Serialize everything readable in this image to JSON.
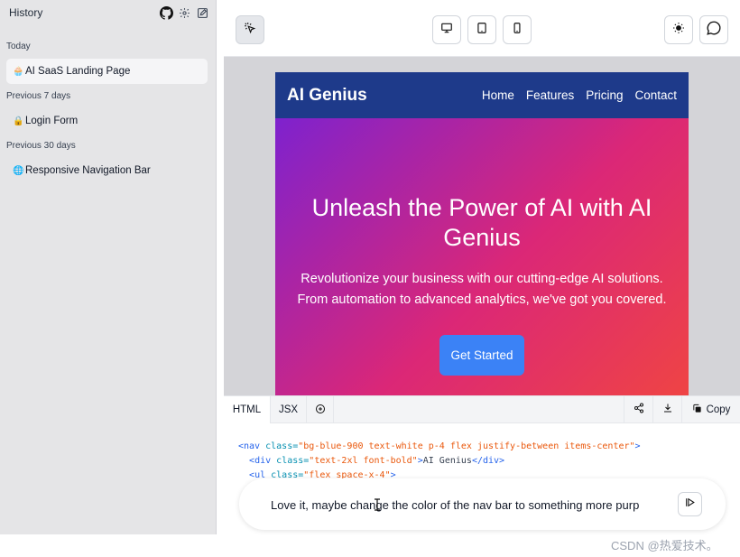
{
  "sidebar": {
    "title": "History",
    "icons": [
      "github-icon",
      "gear-icon",
      "edit-icon"
    ],
    "sections": [
      {
        "label": "Today",
        "items": [
          {
            "emoji": "🧁",
            "label": "AI SaaS Landing Page"
          }
        ]
      },
      {
        "label": "Previous 7 days",
        "items": [
          {
            "emoji": "🔒",
            "label": "Login Form"
          }
        ]
      },
      {
        "label": "Previous 30 days",
        "items": [
          {
            "emoji": "🌐",
            "label": "Responsive Navigation Bar"
          }
        ]
      }
    ]
  },
  "toolbar": {
    "buttons": [
      "pointer-select-icon",
      "desktop-icon",
      "tablet-icon",
      "mobile-icon",
      "sun-icon",
      "chat-bubble-icon"
    ]
  },
  "preview": {
    "logo": "AI Genius",
    "nav_links": [
      "Home",
      "Features",
      "Pricing",
      "Contact"
    ],
    "hero_title": "Unleash the Power of AI with AI Genius",
    "hero_subtitle": "Revolutionize your business with our cutting-edge AI solutions. From automation to advanced analytics, we've got you covered.",
    "cta": "Get Started",
    "colors": {
      "nav": "#1e3a8a",
      "gradient_start": "#7e22ce",
      "gradient_mid": "#db2777",
      "gradient_end": "#ef4444",
      "cta": "#3b82f6"
    }
  },
  "code_panel": {
    "tabs": [
      "HTML",
      "JSX"
    ],
    "copy_label": "Copy",
    "lines": [
      {
        "tag_open": "<nav",
        "attr": "class=",
        "val": "\"bg-blue-900 text-white p-4 flex justify-between items-center\"",
        "rest": "",
        "tag_close": ">"
      },
      {
        "tag_open": "<div",
        "attr": "class=",
        "val": "\"text-2xl font-bold\"",
        "rest": "AI Genius",
        "tag_close": "</div>"
      },
      {
        "tag_open": "<ul",
        "attr": "class=",
        "val": "\"flex space-x-4\"",
        "rest": "",
        "tag_close": ">"
      }
    ]
  },
  "prompt": {
    "value": "Love it, maybe change the color of the nav bar to something more purp"
  },
  "watermark": "CSDN @热爱技术。"
}
